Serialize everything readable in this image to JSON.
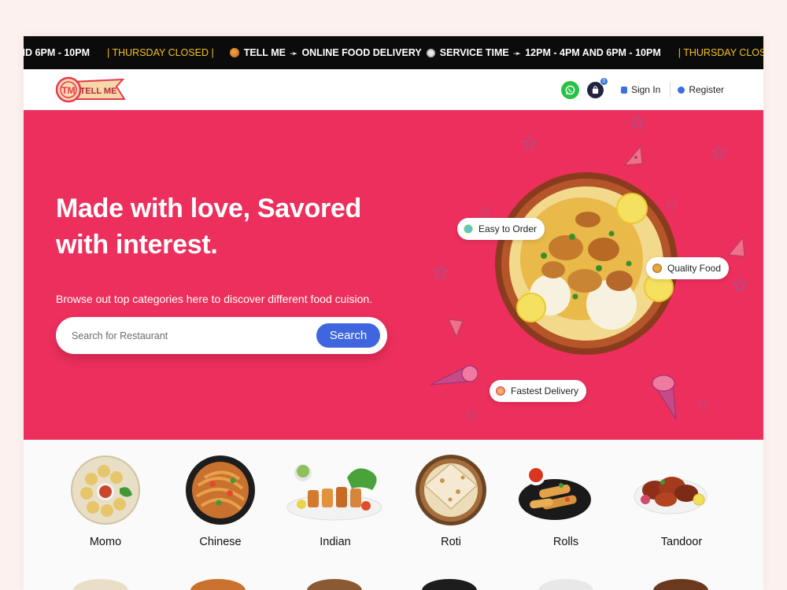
{
  "ticker": {
    "items": [
      {
        "text": "ND 6PM - 10PM",
        "style": "white"
      },
      {
        "text": "| THURSDAY CLOSED |",
        "style": "yellow"
      },
      {
        "icon": "logo-icon",
        "text": "TELL ME",
        "style": "white"
      },
      {
        "text": "➛",
        "style": "arrow"
      },
      {
        "text": "ONLINE FOOD DELIVERY",
        "style": "white"
      },
      {
        "icon": "clock-icon",
        "text": "SERVICE TIME",
        "style": "white"
      },
      {
        "text": "➛",
        "style": "arrow"
      },
      {
        "text": "12PM - 4PM AND 6PM - 10PM",
        "style": "white"
      },
      {
        "text": "| THURSDAY CLOSED |",
        "style": "yellow"
      }
    ]
  },
  "header": {
    "logo_text": "TELL ME",
    "cart_count": "0",
    "sign_in": "Sign In",
    "register": "Register"
  },
  "hero": {
    "title": "Made with love, Savored with interest.",
    "subtitle": "Browse out top categories here to discover different food cuision.",
    "search_placeholder": "Search for Restaurant",
    "search_button": "Search",
    "badges": {
      "easy": "Easy to Order",
      "quality": "Quality Food",
      "fast": "Fastest Delivery"
    }
  },
  "categories": [
    {
      "label": "Momo",
      "icon": "momo-icon"
    },
    {
      "label": "Chinese",
      "icon": "chinese-icon"
    },
    {
      "label": "Indian",
      "icon": "indian-icon"
    },
    {
      "label": "Roti",
      "icon": "roti-icon"
    },
    {
      "label": "Rolls",
      "icon": "rolls-icon"
    },
    {
      "label": "Tandoor",
      "icon": "tandoor-icon"
    }
  ],
  "colors": {
    "hero_bg": "#ec2f5c",
    "search_button": "#3f66df",
    "ticker_bg": "#0b0b0b",
    "ticker_highlight": "#f5c21b",
    "whatsapp": "#25c244"
  }
}
